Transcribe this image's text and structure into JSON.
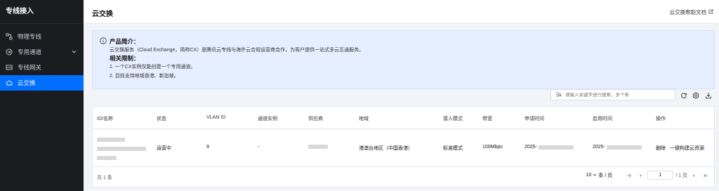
{
  "sidebar": {
    "title": "专线接入",
    "items": [
      {
        "label": "物理专线",
        "icon": "physical-line-icon"
      },
      {
        "label": "专用通道",
        "icon": "channel-icon",
        "expandable": true
      },
      {
        "label": "专线网关",
        "icon": "gateway-icon"
      },
      {
        "label": "云交换",
        "icon": "cloud-icon",
        "active": true
      }
    ]
  },
  "header": {
    "title": "云交换",
    "help_link": "云交换帮助文档"
  },
  "info": {
    "intro_title": "产品简介：",
    "intro_text": "云交换服务（Cloud Exchange，简称CX）是腾讯云专线与海外云合规运营商合作，为客户提供一站式多云互通服务。",
    "limits_title": "相关限制：",
    "limits": [
      "1. 一个CX实例仅能创建一个专用通道。",
      "2. 目前支持地域香港、新加坡。"
    ]
  },
  "search": {
    "placeholder": "请输入关键字进行搜索，多个条"
  },
  "table": {
    "columns": [
      "ID/名称",
      "状态",
      "VLAN ID",
      "通道实例",
      "供应商",
      "地域",
      "接入模式",
      "带宽",
      "申请时间",
      "启用时间",
      "操作"
    ],
    "rows": [
      {
        "id_name": "",
        "status": "运营中",
        "vlan_id": "9",
        "channel": "-",
        "vendor": "",
        "region": "港澳台地区（中国香港）",
        "mode": "标准模式",
        "bandwidth": "100Mbps",
        "apply_time": "2025-",
        "enable_time": "2025-",
        "action_delete": "删除",
        "action_build": "一键构建云资源"
      }
    ]
  },
  "footer": {
    "total": "共 1 条",
    "page_size": "10",
    "page_size_unit": "条 / 页",
    "current_page": "1",
    "page_total": "/ 1 页"
  },
  "colors": {
    "accent": "#006eff",
    "running": "#0abf5b",
    "sidebar_bg": "#1b1c20"
  }
}
